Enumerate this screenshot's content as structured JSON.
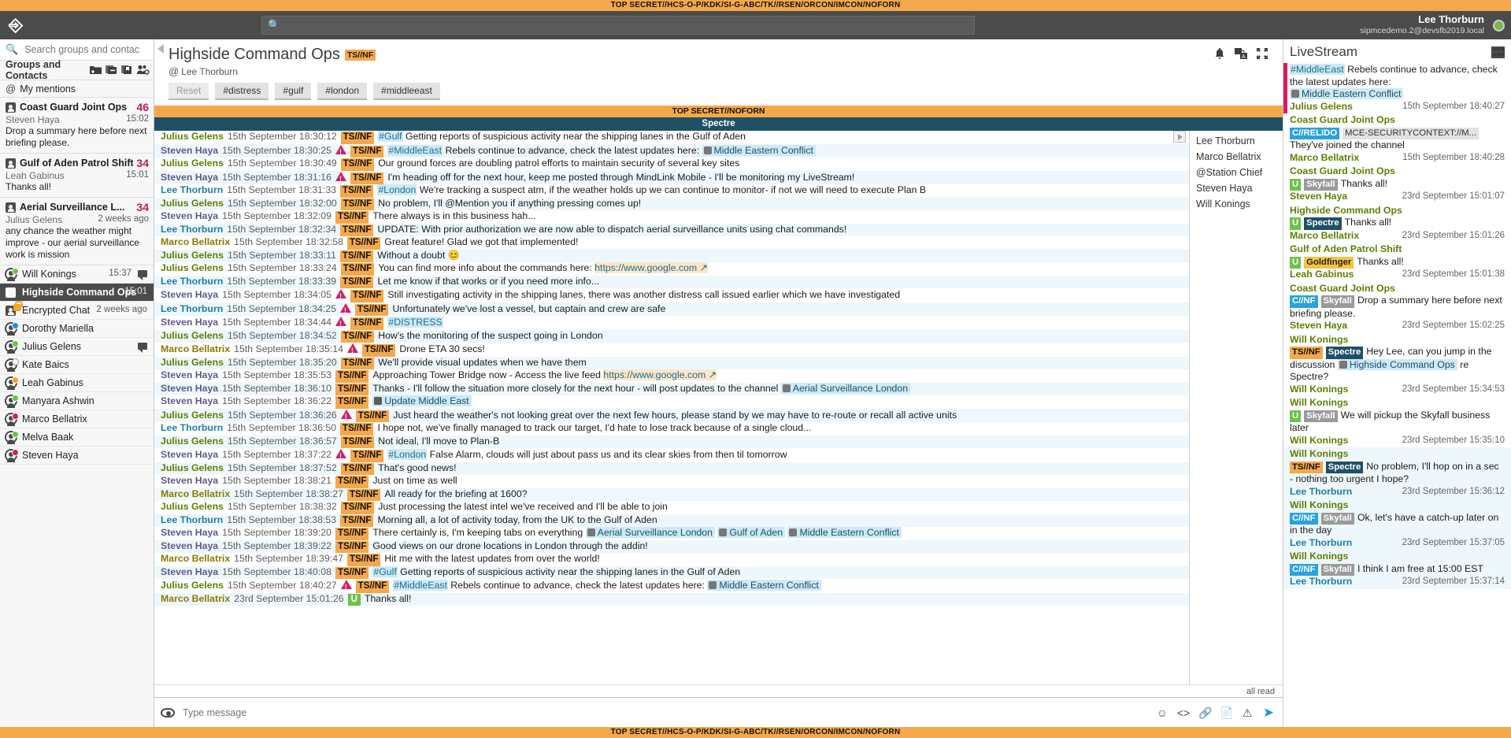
{
  "classification": {
    "top": "TOP SECRET//HCS-O-P/KDK/SI-G-ABC/TK//RSEN/ORCON/IMCON/NOFORN",
    "bottom": "TOP SECRET//HCS-O-P/KDK/SI-G-ABC/TK//RSEN/ORCON/IMCON/NOFORN",
    "band": "TOP SECRET//NOFORN",
    "accent": "#F5A84B"
  },
  "titlebar": {
    "logo": "mindlink-logo-icon",
    "search_placeholder": "",
    "user_name": "Lee Thorburn",
    "user_sip": "sipmcedemo.2@devsfb2019.local",
    "presence": "#7ab648"
  },
  "sidebar": {
    "search_placeholder": "Search groups and contacts",
    "header_label": "Groups and Contacts",
    "header_icons": [
      "new-folder-icon",
      "remove-group-icon",
      "bookmark-icon",
      "add-contact-icon"
    ],
    "mentions_label": "My mentions",
    "groups": [
      {
        "name": "Coast Guard Joint Ops",
        "count": "46",
        "sender": "Steven Haya",
        "time": "15:02",
        "preview": "Drop a summary here before next briefing please."
      },
      {
        "name": "Gulf of Aden Patrol Shift",
        "count": "34",
        "sender": "Leah Gabinus",
        "time": "15:01",
        "preview": "Thanks all!"
      },
      {
        "name": "Aerial Surveillance L...",
        "count": "34",
        "sender": "Julius Gelens",
        "time": "2 weeks ago",
        "preview": "any chance the weather might improve - our aerial surveillance work is mission"
      }
    ],
    "contacts": [
      {
        "name": "Will Konings",
        "presence": "#6cc24a",
        "has_chat_icon": true,
        "selected": false,
        "locked": false,
        "time": "15:37",
        "type": "contact"
      },
      {
        "name": "Highside Command Ops",
        "presence": "",
        "has_chat_icon": false,
        "selected": true,
        "locked": false,
        "time": "15:01",
        "type": "group"
      },
      {
        "name": "Encrypted Chat",
        "presence": "",
        "has_chat_icon": false,
        "selected": false,
        "locked": true,
        "time": "2 weeks ago",
        "type": "group"
      },
      {
        "name": "Dorothy Mariella",
        "presence": "#1a8cd8",
        "has_chat_icon": false,
        "selected": false,
        "locked": false,
        "time": "",
        "type": "contact"
      },
      {
        "name": "Julius Gelens",
        "presence": "#6cc24a",
        "has_chat_icon": true,
        "selected": false,
        "locked": false,
        "time": "",
        "type": "contact"
      },
      {
        "name": "Kate Baics",
        "presence": "#ffffff",
        "has_chat_icon": false,
        "selected": false,
        "locked": false,
        "time": "",
        "type": "contact"
      },
      {
        "name": "Leah Gabinus",
        "presence": "#F5A623",
        "has_chat_icon": false,
        "selected": false,
        "locked": false,
        "time": "",
        "type": "contact"
      },
      {
        "name": "Manyara Ashwin",
        "presence": "#6cc24a",
        "has_chat_icon": false,
        "selected": false,
        "locked": false,
        "time": "",
        "type": "contact"
      },
      {
        "name": "Marco Bellatrix",
        "presence": "#d81b60",
        "has_chat_icon": false,
        "selected": false,
        "locked": false,
        "time": "",
        "type": "contact"
      },
      {
        "name": "Melva Baak",
        "presence": "#6cc24a",
        "has_chat_icon": false,
        "selected": false,
        "locked": false,
        "time": "",
        "type": "contact"
      },
      {
        "name": "Steven Haya",
        "presence": "#d81b60",
        "has_chat_icon": false,
        "selected": false,
        "locked": false,
        "time": "",
        "type": "contact"
      }
    ]
  },
  "chat": {
    "title": "Highside Command Ops",
    "classification_tag": "TS//NF",
    "owner": "Lee Thorburn",
    "filters": [
      "Reset",
      "#distress",
      "#gulf",
      "#london",
      "#middleeast"
    ],
    "header_icons": [
      "bell-icon",
      "translate-icon",
      "expand-icon"
    ],
    "room_band": "Spectre",
    "all_read": "all read",
    "composer_placeholder": "Type message",
    "composer_icons": [
      "emoji-icon",
      "code-icon",
      "link-icon",
      "document-icon",
      "alert-icon",
      "send-icon"
    ],
    "members": [
      "Lee Thorburn",
      "Marco Bellatrix",
      "@Station Chief",
      "Steven Haya",
      "Will Konings"
    ],
    "messages": [
      {
        "user": "Julius Gelens",
        "uclass": "u-julius",
        "time": "15th September 18:30:12",
        "warn": false,
        "class": "TS//NF",
        "hash": "#Gulf",
        "text": " Getting reports of suspicious activity near the shipping lanes in the Gulf of Aden",
        "alt": false
      },
      {
        "user": "Steven Haya",
        "uclass": "u-steven",
        "time": "15th September 18:30:25",
        "warn": true,
        "class": "TS//NF",
        "hash": "#MiddleEast",
        "text": " Rebels continue to advance, check the latest updates here: ",
        "chip": "Middle Eastern Conflict",
        "alt": true
      },
      {
        "user": "Julius Gelens",
        "uclass": "u-julius",
        "time": "15th September 18:30:49",
        "warn": false,
        "class": "TS//NF",
        "text": "Our ground forces are doubling patrol efforts to maintain security of several key sites",
        "alt": false
      },
      {
        "user": "Steven Haya",
        "uclass": "u-steven",
        "time": "15th September 18:31:16",
        "warn": true,
        "class": "TS//NF",
        "text": "I'm heading off for the next hour, keep me posted through MindLink Mobile - I'll be monitoring my LiveStream!",
        "alt": true
      },
      {
        "user": "Lee Thorburn",
        "uclass": "u-lee",
        "time": "15th September 18:31:33",
        "warn": false,
        "class": "TS//NF",
        "hash": "#London",
        "text": " We're tracking a suspect atm, if the weather holds up we can continue to monitor- if not we will need to execute Plan B",
        "alt": false
      },
      {
        "user": "Julius Gelens",
        "uclass": "u-julius",
        "time": "15th September 18:32:00",
        "warn": false,
        "class": "TS//NF",
        "text": "No problem, I'll @Mention you if anything pressing comes up!",
        "alt": true
      },
      {
        "user": "Steven Haya",
        "uclass": "u-steven",
        "time": "15th September 18:32:09",
        "warn": false,
        "class": "TS//NF",
        "text": "There always is in this business hah...",
        "alt": false
      },
      {
        "user": "Lee Thorburn",
        "uclass": "u-lee",
        "time": "15th September 18:32:34",
        "warn": false,
        "class": "TS//NF",
        "text": "UPDATE: With prior authorization we are now able to dispatch aerial surveillance units using chat commands!",
        "alt": true
      },
      {
        "user": "Marco Bellatrix",
        "uclass": "u-marco",
        "time": "15th September 18:32:58",
        "warn": false,
        "class": "TS//NF",
        "text": "Great feature! Glad we got that implemented!",
        "alt": false
      },
      {
        "user": "Julius Gelens",
        "uclass": "u-julius",
        "time": "15th September 18:33:11",
        "warn": false,
        "class": "TS//NF",
        "text": "Without a doubt 😊",
        "alt": true
      },
      {
        "user": "Julius Gelens",
        "uclass": "u-julius",
        "time": "15th September 18:33:24",
        "warn": false,
        "class": "TS//NF",
        "text": "You can find more info about the commands here: ",
        "link": "https://www.google.com",
        "alt": false
      },
      {
        "user": "Lee Thorburn",
        "uclass": "u-lee",
        "time": "15th September 18:33:39",
        "warn": false,
        "class": "TS//NF",
        "text": "Let me know if that works or if you need more info...",
        "alt": true
      },
      {
        "user": "Steven Haya",
        "uclass": "u-steven",
        "time": "15th September 18:34:05",
        "warn": true,
        "class": "TS//NF",
        "text": "Still investigating activity in the shipping lanes, there was another distress call issued earlier which we have investigated",
        "alt": false
      },
      {
        "user": "Lee Thorburn",
        "uclass": "u-lee",
        "time": "15th September 18:34:25",
        "warn": true,
        "class": "TS//NF",
        "text": "Unfortunately we've lost a vessel, but captain and crew are safe",
        "alt": true
      },
      {
        "user": "Steven Haya",
        "uclass": "u-steven",
        "time": "15th September 18:34:44",
        "warn": true,
        "class": "TS//NF",
        "hash": "#DISTRESS",
        "text": "",
        "alt": false
      },
      {
        "user": "Julius Gelens",
        "uclass": "u-julius",
        "time": "15th September 18:34:52",
        "warn": false,
        "class": "TS//NF",
        "text": "How's the monitoring of the suspect going in London",
        "alt": true
      },
      {
        "user": "Marco Bellatrix",
        "uclass": "u-marco",
        "time": "15th September 18:35:14",
        "warn": true,
        "class": "TS//NF",
        "text": "Drone ETA 30 secs!",
        "alt": false
      },
      {
        "user": "Julius Gelens",
        "uclass": "u-julius",
        "time": "15th September 18:35:20",
        "warn": false,
        "class": "TS//NF",
        "text": "We'll provide visual updates when we have them",
        "alt": true
      },
      {
        "user": "Steven Haya",
        "uclass": "u-steven",
        "time": "15th September 18:35:53",
        "warn": false,
        "class": "TS//NF",
        "text": "Approaching Tower Bridge now - Access the live feed ",
        "link": "https://www.google.com",
        "alt": false
      },
      {
        "user": "Steven Haya",
        "uclass": "u-steven",
        "time": "15th September 18:36:10",
        "warn": false,
        "class": "TS//NF",
        "text": "Thanks - I'll follow the situation more closely for the next hour - will post updates to the channel ",
        "chip": "Aerial Surveillance London",
        "alt": true
      },
      {
        "user": "Steven Haya",
        "uclass": "u-steven",
        "time": "15th September 18:36:22",
        "warn": false,
        "class": "TS//NF",
        "text": "",
        "doc": "Update Middle East",
        "alt": false
      },
      {
        "user": "Julius Gelens",
        "uclass": "u-julius",
        "time": "15th September 18:36:26",
        "warn": true,
        "class": "TS//NF",
        "text": "Just heard the weather's not looking great over the next few hours, please stand by we may have to re-route or recall all active units",
        "alt": true
      },
      {
        "user": "Lee Thorburn",
        "uclass": "u-lee",
        "time": "15th September 18:36:50",
        "warn": false,
        "class": "TS//NF",
        "text": "I hope not, we've finally managed to track our target, I'd hate to lose track because of a single cloud...",
        "alt": false
      },
      {
        "user": "Julius Gelens",
        "uclass": "u-julius",
        "time": "15th September 18:36:57",
        "warn": false,
        "class": "TS//NF",
        "text": "Not ideal, I'll move to Plan-B",
        "alt": true
      },
      {
        "user": "Steven Haya",
        "uclass": "u-steven",
        "time": "15th September 18:37:22",
        "warn": true,
        "class": "TS//NF",
        "hash": "#London",
        "text": " False Alarm, clouds will just about pass us and its clear skies from then til tomorrow",
        "alt": false
      },
      {
        "user": "Julius Gelens",
        "uclass": "u-julius",
        "time": "15th September 18:37:52",
        "warn": false,
        "class": "TS//NF",
        "text": "That's good news!",
        "alt": true
      },
      {
        "user": "Steven Haya",
        "uclass": "u-steven",
        "time": "15th September 18:38:21",
        "warn": false,
        "class": "TS//NF",
        "text": "Just on time as well",
        "alt": false
      },
      {
        "user": "Marco Bellatrix",
        "uclass": "u-marco",
        "time": "15th September 18:38:27",
        "warn": false,
        "class": "TS//NF",
        "text": "All ready for the briefing at 1600?",
        "alt": true
      },
      {
        "user": "Julius Gelens",
        "uclass": "u-julius",
        "time": "15th September 18:38:32",
        "warn": false,
        "class": "TS//NF",
        "text": "Just processing the latest intel we've received and I'll be able to join",
        "alt": false
      },
      {
        "user": "Lee Thorburn",
        "uclass": "u-lee",
        "time": "15th September 18:38:53",
        "warn": false,
        "class": "TS//NF",
        "text": "Morning all, a lot of activity today, from the UK to the Gulf of Aden",
        "alt": true
      },
      {
        "user": "Steven Haya",
        "uclass": "u-steven",
        "time": "15th September 18:39:20",
        "warn": false,
        "class": "TS//NF",
        "text": "There certainly is, I'm keeping tabs on everything ",
        "chips": [
          "Aerial Surveillance London",
          "Gulf of Aden",
          "Middle Eastern Conflict"
        ],
        "alt": false
      },
      {
        "user": "Steven Haya",
        "uclass": "u-steven",
        "time": "15th September 18:39:22",
        "warn": false,
        "class": "TS//NF",
        "text": "Good views on our drone locations in London through the addin!",
        "alt": true
      },
      {
        "user": "Marco Bellatrix",
        "uclass": "u-marco",
        "time": "15th September 18:39:47",
        "warn": false,
        "class": "TS//NF",
        "text": "Hit me with the latest updates from over the world!",
        "alt": false
      },
      {
        "user": "Steven Haya",
        "uclass": "u-steven",
        "time": "15th September 18:40:08",
        "warn": false,
        "class": "TS//NF",
        "hash": "#Gulf",
        "text": " Getting reports of suspicious activity near the shipping lanes in the Gulf of Aden",
        "alt": true
      },
      {
        "user": "Julius Gelens",
        "uclass": "u-julius",
        "time": "15th September 18:40:27",
        "warn": true,
        "class": "TS//NF",
        "hash": "#MiddleEast",
        "text": " Rebels continue to advance, check the latest updates here: ",
        "chip": "Middle Eastern Conflict",
        "alt": false
      },
      {
        "user": "Marco Bellatrix",
        "uclass": "u-marco",
        "time": "23rd September 15:01:26",
        "warn": false,
        "class": "U",
        "class_green": true,
        "text": "Thanks all!",
        "alt": true
      }
    ]
  },
  "livestream": {
    "title": "LiveStream",
    "config_icon": "livestream-config-icon",
    "items": [
      {
        "partial": true,
        "red_bar": true,
        "hash": "#MiddleEast",
        "text_pre": " Rebels continue to advance, check the latest updates here: ",
        "chip": "Middle Eastern Conflict",
        "user": "Julius Gelens",
        "uclass": "ls-group",
        "ts": "15th September 18:40:27",
        "hl": false
      },
      {
        "group": "Coast Guard Joint Ops",
        "badges": [
          {
            "cls": "crelido",
            "label": "C//RELIDO"
          },
          {
            "cls": "mce",
            "label": "MCE-SECURITYCONTEXT://M..."
          }
        ],
        "text": "They've joined the channel",
        "user": "Marco Bellatrix",
        "uclass": "ls-group",
        "ts": "15th September 18:40:28",
        "hl": false
      },
      {
        "group": "Coast Guard Joint Ops",
        "badges": [
          {
            "cls": "u",
            "label": "U"
          },
          {
            "cls": "skyfall",
            "label": "Skyfall"
          }
        ],
        "text": "Thanks all!",
        "user": "Steven Haya",
        "uclass": "ls-group",
        "ts": "23rd September 15:01:07",
        "hl": false
      },
      {
        "group": "Highside Command Ops",
        "badges": [
          {
            "cls": "u",
            "label": "U"
          },
          {
            "cls": "spectre",
            "label": "Spectre"
          }
        ],
        "text": "Thanks all!",
        "user": "Marco Bellatrix",
        "uclass": "ls-group",
        "ts": "23rd September 15:01:26",
        "hl": false
      },
      {
        "group": "Gulf of Aden Patrol Shift",
        "badges": [
          {
            "cls": "u",
            "label": "U"
          },
          {
            "cls": "goldfinger",
            "label": "Goldfinger"
          }
        ],
        "text": "Thanks all!",
        "user": "Leah Gabinus",
        "uclass": "ls-group",
        "ts": "23rd September 15:01:38",
        "hl": false
      },
      {
        "group": "Coast Guard Joint Ops",
        "badges": [
          {
            "cls": "cnf",
            "label": "C//NF"
          },
          {
            "cls": "skyfall",
            "label": "Skyfall"
          }
        ],
        "text": "Drop a summary here before next briefing please.",
        "user": "Steven Haya",
        "uclass": "ls-group",
        "ts": "23rd September 15:02:25",
        "hl": false
      },
      {
        "group": "Will Konings",
        "badges": [
          {
            "cls": "tsnf",
            "label": "TS//NF"
          },
          {
            "cls": "spectre",
            "label": "Spectre"
          }
        ],
        "text": "Hey Lee, can you jump in the discussion ",
        "chip": "Highside Command Ops",
        "text_post": " re Spectre?",
        "user": "Will Konings",
        "uclass": "ls-group",
        "ts": "23rd September 15:34:53",
        "hl": false
      },
      {
        "group": "Will Konings",
        "badges": [
          {
            "cls": "u",
            "label": "U"
          },
          {
            "cls": "skyfall",
            "label": "Skyfall"
          }
        ],
        "text": "We will pickup the Skyfall business later",
        "user": "Will Konings",
        "uclass": "ls-group",
        "ts": "23rd September 15:35:10",
        "hl": false
      },
      {
        "group": "Will Konings",
        "badges": [
          {
            "cls": "tsnf",
            "label": "TS//NF"
          },
          {
            "cls": "spectre",
            "label": "Spectre"
          }
        ],
        "text": "No problem, I'll hop on in a sec - nothing too urgent I hope?",
        "user": "Lee Thorburn",
        "uclass": "ls-group blue",
        "ts": "23rd September 15:36:12",
        "hl": true
      },
      {
        "group": "Will Konings",
        "badges": [
          {
            "cls": "cnf",
            "label": "C//NF"
          },
          {
            "cls": "skyfall",
            "label": "Skyfall"
          }
        ],
        "text": "Ok, let's have a catch-up later on in the day",
        "user": "Lee Thorburn",
        "uclass": "ls-group blue",
        "ts": "23rd September 15:37:05",
        "hl": true
      },
      {
        "group": "Will Konings",
        "badges": [
          {
            "cls": "cnf",
            "label": "C//NF"
          },
          {
            "cls": "skyfall",
            "label": "Skyfall"
          }
        ],
        "text": "I think I am free at 15:00 EST",
        "user": "Lee Thorburn",
        "uclass": "ls-group blue",
        "ts": "23rd September 15:37:14",
        "hl": true
      }
    ]
  }
}
